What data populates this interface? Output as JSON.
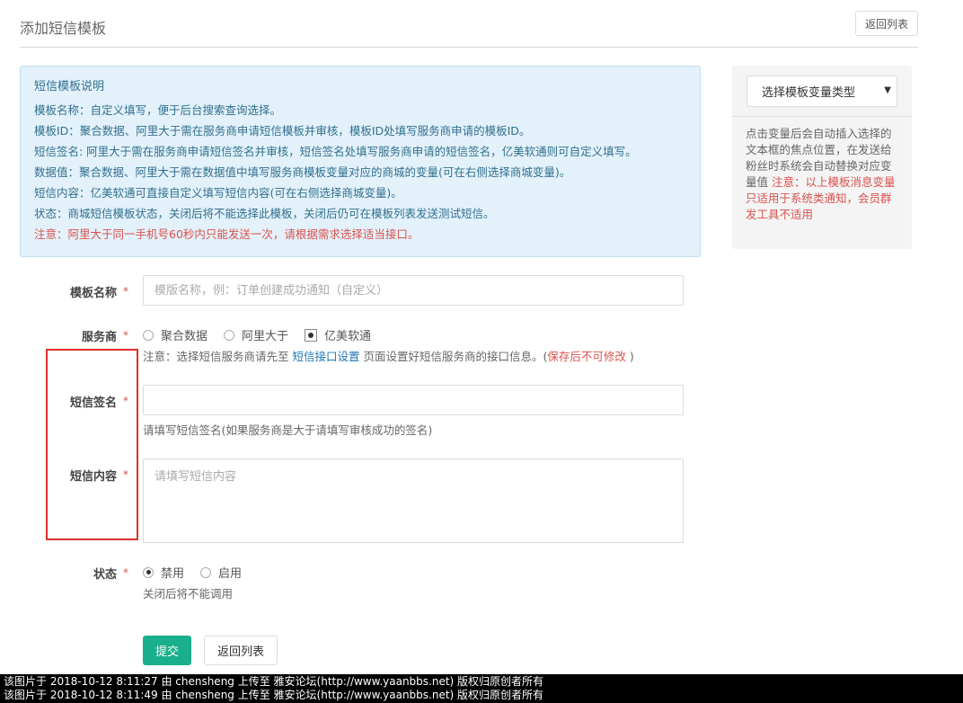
{
  "header": {
    "title": "添加短信模板",
    "back_list_label": "返回列表"
  },
  "info": {
    "title": "短信模板说明",
    "lines": [
      "模板名称：自定义填写，便于后台搜索查询选择。",
      "模板ID：聚合数据、阿里大于需在服务商申请短信模板并审核，模板ID处填写服务商申请的模板ID。",
      "短信签名: 阿里大于需在服务商申请短信签名并审核，短信签名处填写服务商申请的短信签名，亿美软通则可自定义填写。",
      "数据值：聚合数据、阿里大于需在数据值中填写服务商模板变量对应的商城的变量(可在右侧选择商城变量)。",
      "短信内容：亿美软通可直接自定义填写短信内容(可在右侧选择商城变量)。",
      "状态：商城短信模板状态，关闭后将不能选择此模板，关闭后仍可在模板列表发送测试短信。"
    ],
    "warning": "注意：阿里大于同一手机号60秒内只能发送一次，请根据需求选择适当接口。"
  },
  "side_panel": {
    "select_label": "选择模板变量类型",
    "caret": "▼",
    "description": "点击变量后会自动插入选择的文本框的焦点位置，在发送给粉丝时系统会自动替换对应变量值",
    "warning": "注意：以上模板消息变量只适用于系统类通知，会员群发工具不适用"
  },
  "form": {
    "required_mark": "*",
    "template_name": {
      "label": "模板名称",
      "placeholder": "模版名称，例：订单创建成功通知（自定义）",
      "value": ""
    },
    "provider": {
      "label": "服务商",
      "options": [
        "聚合数据",
        "阿里大于",
        "亿美软通"
      ],
      "selected": "亿美软通",
      "help_prefix": "注意：选择短信服务商请先至 ",
      "help_link": "短信接口设置",
      "help_middle": " 页面设置好短信服务商的接口信息。(",
      "help_warn": "保存后不可修改",
      "help_suffix": " )"
    },
    "signature": {
      "label": "短信签名",
      "value": "",
      "help": "请填写短信签名(如果服务商是大于请填写审核成功的签名)"
    },
    "content": {
      "label": "短信内容",
      "placeholder": "请填写短信内容",
      "value": ""
    },
    "status": {
      "label": "状态",
      "options": [
        "禁用",
        "启用"
      ],
      "selected": "禁用",
      "help": "关闭后将不能调用"
    }
  },
  "actions": {
    "submit_label": "提交",
    "back_label": "返回列表"
  },
  "watermark": {
    "lines": [
      "该图片于 2018-10-12 8:11:27 由 chensheng 上传至 雅安论坛(http://www.yaanbbs.net) 版权归原创者所有",
      "该图片于 2018-10-12 8:11:49 由 chensheng 上传至 雅安论坛(http://www.yaanbbs.net) 版权归原创者所有"
    ]
  },
  "colors": {
    "accent": "#1aaf8b",
    "info_bg": "#e3f1fa",
    "info_text": "#31708f",
    "warning": "#d9534f",
    "annotation": "#d9302c"
  }
}
